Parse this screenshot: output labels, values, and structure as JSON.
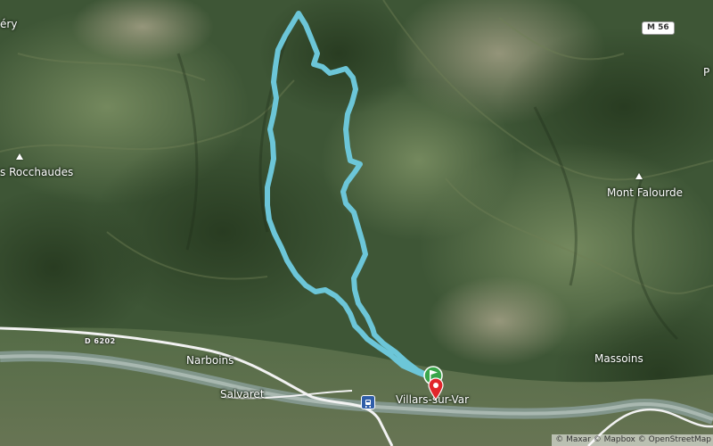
{
  "map": {
    "places": [
      {
        "id": "ery",
        "label": "éry"
      },
      {
        "id": "rocchaudes",
        "label": "s Rocchaudes"
      },
      {
        "id": "mont-falourde",
        "label": "Mont Falourde"
      },
      {
        "id": "narboins",
        "label": "Narboins"
      },
      {
        "id": "salvaret",
        "label": "Salvaret"
      },
      {
        "id": "massoins",
        "label": "Massoins"
      },
      {
        "id": "villars",
        "label": "Villars-sur-Var"
      },
      {
        "id": "p-edge",
        "label": "P"
      }
    ],
    "roads": {
      "shield": "M 56",
      "label": "D 6202"
    },
    "route": {
      "color": "#6cc6d8",
      "start_marker_color": "#3aa54a",
      "end_marker_color": "#e1252b"
    },
    "attribution": "© Maxar © Mapbox © OpenStreetMap"
  }
}
